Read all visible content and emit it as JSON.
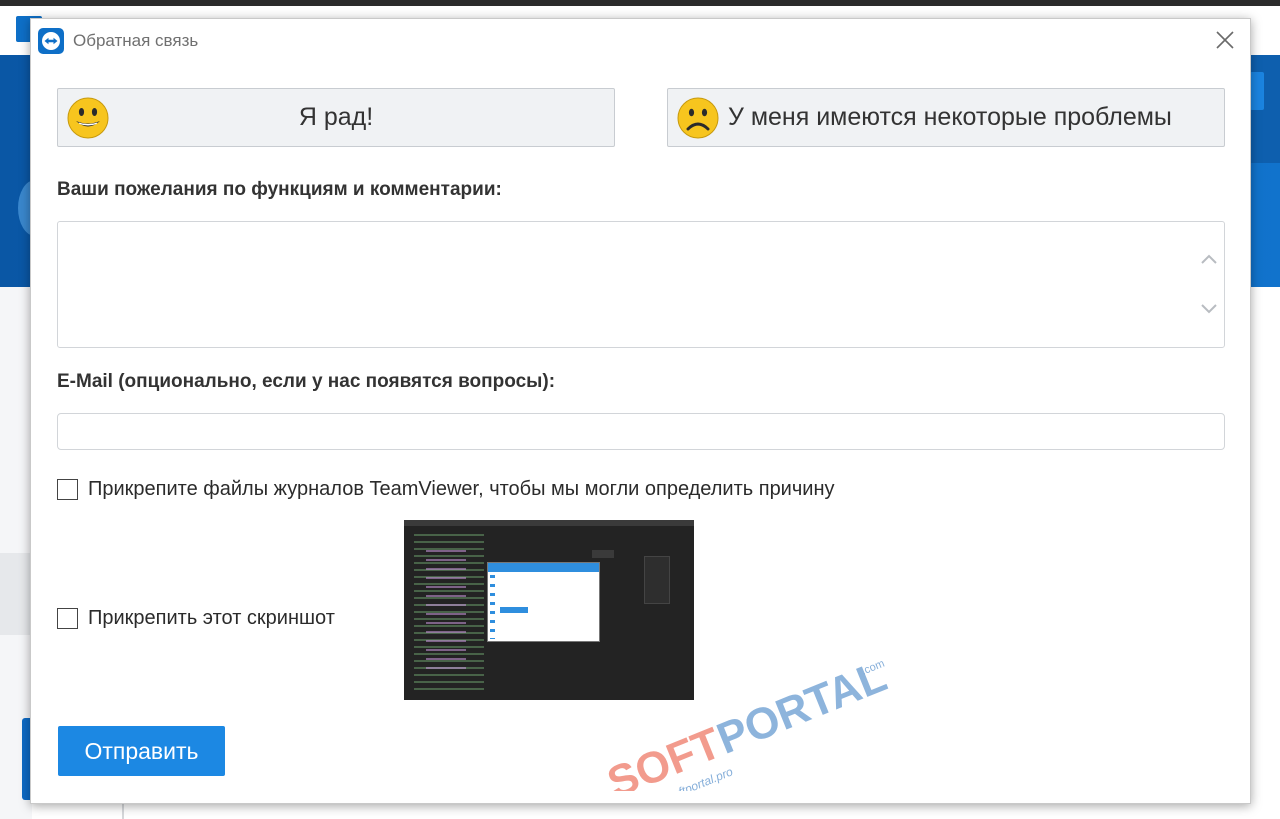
{
  "dialog": {
    "title": "Обратная связь",
    "close_icon": "close-icon",
    "app_icon": "teamviewer-logo-icon"
  },
  "mood": {
    "happy_label": "Я рад!",
    "happy_icon": "smiling-face-icon",
    "sad_label": "У меня имеются некоторые проблемы",
    "sad_icon": "frowning-face-icon"
  },
  "comments": {
    "label": "Ваши пожелания по функциям и комментарии:",
    "value": ""
  },
  "email": {
    "label": "E-Mail (опционально, если у нас появятся вопросы):",
    "value": ""
  },
  "attach_logs": {
    "label": "Прикрепите файлы журналов TeamViewer, чтобы мы могли определить причину",
    "checked": false
  },
  "attach_screenshot": {
    "label": "Прикрепить этот скриншот",
    "checked": false
  },
  "send_button": "Отправить",
  "watermark": {
    "brand_left": "SOFT",
    "brand_right": "PORTAL",
    "url": "www.softportal.pro",
    "tld": ".com"
  },
  "colors": {
    "accent": "#1c88e3",
    "brand_blue": "#0e6fc7",
    "emoji_yellow": "#f7c51e",
    "watermark_red": "#f08a7a",
    "watermark_blue": "#7aa7d6"
  }
}
